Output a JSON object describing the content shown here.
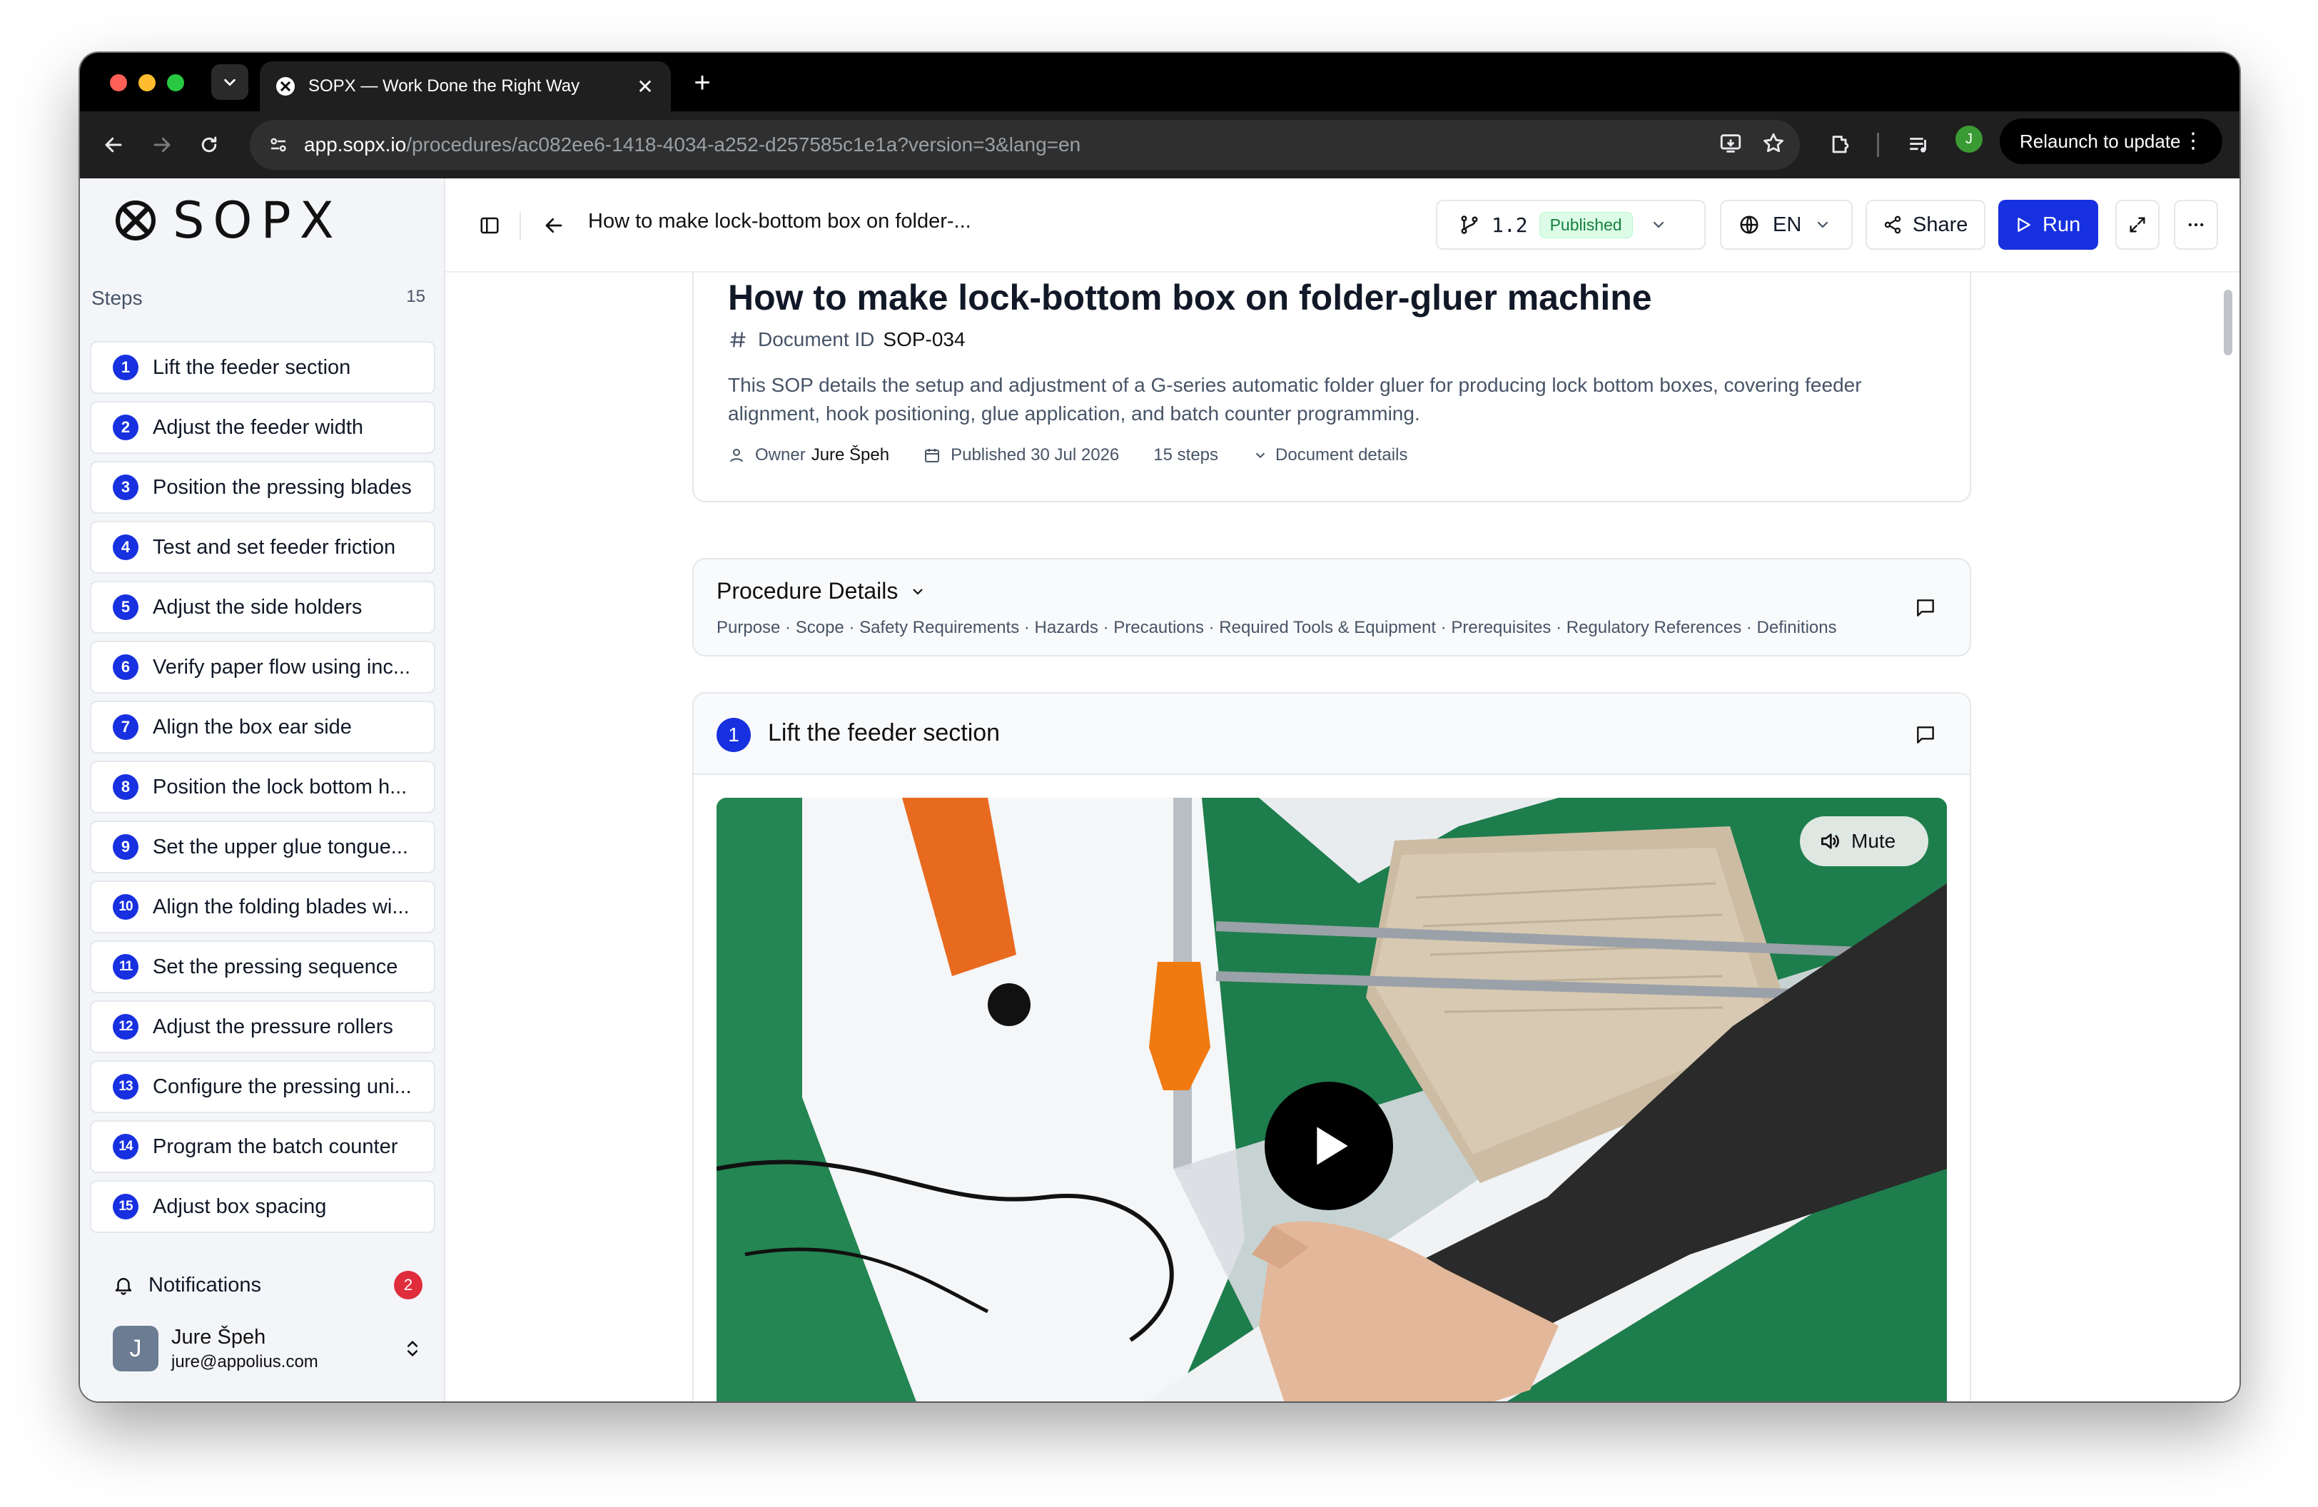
{
  "browser": {
    "tab_title": "SOPX — Work Done the Right Way",
    "url_host": "app.sopx.io",
    "url_path": "/procedures/ac082ee6-1418-4034-a252-d257585c1e1a?version=3&lang=en",
    "relaunch_label": "Relaunch to update",
    "profile_initial": "J"
  },
  "brand": {
    "logo_text": "SOPX"
  },
  "sidebar": {
    "steps_label": "Steps",
    "steps_count": "15",
    "steps": [
      {
        "num": "1",
        "label": "Lift the feeder section"
      },
      {
        "num": "2",
        "label": "Adjust the feeder width"
      },
      {
        "num": "3",
        "label": "Position the pressing blades"
      },
      {
        "num": "4",
        "label": "Test and set feeder friction"
      },
      {
        "num": "5",
        "label": "Adjust the side holders"
      },
      {
        "num": "6",
        "label": "Verify paper flow using inc..."
      },
      {
        "num": "7",
        "label": "Align the box ear side"
      },
      {
        "num": "8",
        "label": "Position the lock bottom h..."
      },
      {
        "num": "9",
        "label": "Set the upper glue tongue..."
      },
      {
        "num": "10",
        "label": "Align the folding blades wi..."
      },
      {
        "num": "11",
        "label": "Set the pressing sequence"
      },
      {
        "num": "12",
        "label": "Adjust the pressure rollers"
      },
      {
        "num": "13",
        "label": "Configure the pressing uni..."
      },
      {
        "num": "14",
        "label": "Program the batch counter"
      },
      {
        "num": "15",
        "label": "Adjust box spacing"
      }
    ],
    "notifications_label": "Notifications",
    "notifications_count": "2",
    "user_initial": "J",
    "user_name": "Jure Špeh",
    "user_email": "jure@appolius.com"
  },
  "header": {
    "title": "How to make lock-bottom box on folder-...",
    "version": "1.2",
    "status": "Published",
    "language": "EN",
    "share_label": "Share",
    "run_label": "Run"
  },
  "document": {
    "title": "How to make lock-bottom box on folder-gluer machine",
    "id_label": "Document ID",
    "id_value": "SOP-034",
    "description": "This SOP details the setup and adjustment of a G-series automatic folder gluer for producing lock bottom boxes, covering feeder alignment, hook positioning, glue application, and batch counter programming.",
    "owner_label": "Owner",
    "owner_name": "Jure Špeh",
    "published": "Published 30 Jul 2026",
    "steps_count": "15 steps",
    "details_label": "Document details"
  },
  "procedure_details": {
    "title": "Procedure Details",
    "sections": "Purpose · Scope · Safety Requirements · Hazards · Precautions · Required Tools & Equipment · Prerequisites · Regulatory References · Definitions"
  },
  "current_step": {
    "num": "1",
    "title": "Lift the feeder section",
    "mute_label": "Mute"
  },
  "colors": {
    "accent": "#1730e0",
    "published_bg": "#dcfce7",
    "published_text": "#15803d",
    "badge_red": "#e02d3c"
  }
}
